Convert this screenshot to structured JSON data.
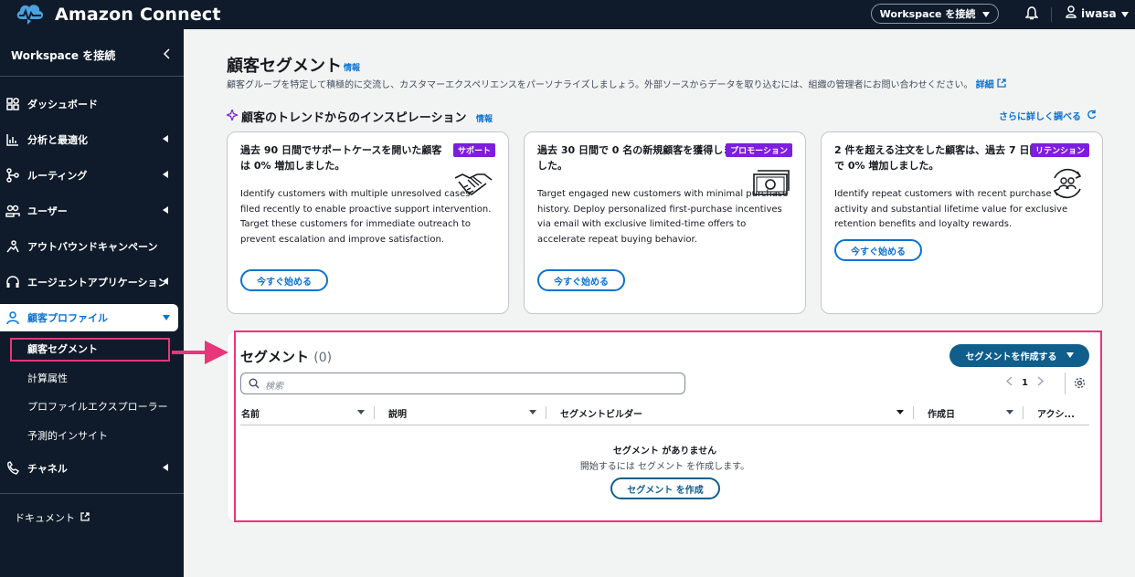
{
  "app": {
    "name": "Amazon Connect"
  },
  "topbar": {
    "workspace_button": "Workspace を接続",
    "user": "iwasa"
  },
  "sidebar": {
    "header": "Workspace を接続",
    "items": [
      {
        "label": "ダッシュボード",
        "icon": "dashboard-icon"
      },
      {
        "label": "分析と最適化",
        "icon": "analytics-icon"
      },
      {
        "label": "ルーティング",
        "icon": "routing-icon"
      },
      {
        "label": "ユーザー",
        "icon": "users-icon"
      },
      {
        "label": "アウトバウンドキャンペーン",
        "icon": "campaign-icon"
      },
      {
        "label": "エージェントアプリケーション",
        "icon": "headset-icon"
      },
      {
        "label": "顧客プロファイル",
        "icon": "profile-icon"
      },
      {
        "label": "チャネル",
        "icon": "channel-icon"
      }
    ],
    "sub_items": [
      "顧客セグメント",
      "計算属性",
      "プロファイルエクスプローラー",
      "予測的インサイト"
    ],
    "docs": "ドキュメント"
  },
  "page": {
    "title": "顧客セグメント",
    "info": "情報",
    "description": "顧客グループを特定して積極的に交流し、カスタマーエクスペリエンスをパーソナライズしましょう。外部ソースからデータを取り込むには、組織の管理者にお問い合わせください。",
    "description_link": "詳細"
  },
  "inspiration": {
    "title": "顧客のトレンドからのインスピレーション",
    "info": "情報",
    "more": "さらに詳しく調べる",
    "cards": [
      {
        "title": "過去 90 日間でサポートケースを開いた顧客は 0% 増加しました。",
        "badge": "サポート",
        "icon": "handshake-icon",
        "body": "Identify customers with multiple unresolved cases filed recently to enable proactive support intervention. Target these customers for immediate outreach to prevent escalation and improve satisfaction.",
        "button": "今すぐ始める"
      },
      {
        "title": "過去 30 日間で 0 名の新規顧客を獲得しました。",
        "badge": "プロモーション",
        "icon": "money-icon",
        "body": "Target engaged new customers with minimal purchase history. Deploy personalized first-purchase incentives via email with exclusive limited-time offers to accelerate repeat buying behavior.",
        "button": "今すぐ始める"
      },
      {
        "title": "2 件を超える注文をした顧客は、過去 7 日間で 0% 増加しました。",
        "badge": "リテンション",
        "icon": "retention-icon",
        "body": "Identify repeat customers with recent purchase activity and substantial lifetime value for exclusive retention benefits and loyalty rewards.",
        "button": "今すぐ始める"
      }
    ]
  },
  "segments": {
    "title": "セグメント",
    "count": "(0)",
    "create_button": "セグメントを作成する",
    "search_placeholder": "検索",
    "page": "1",
    "columns": [
      "名前",
      "説明",
      "セグメントビルダー",
      "作成日",
      "アクシ..."
    ],
    "empty_title": "セグメント がありません",
    "empty_desc": "開始するには セグメント を作成します。",
    "empty_button": "セグメント を作成"
  },
  "colors": {
    "nav_bg": "#0f1b2a",
    "accent": "#0972d3",
    "badge": "#7d1ddf",
    "highlight": "#e8367a",
    "primary_btn": "#0f5e8c"
  }
}
